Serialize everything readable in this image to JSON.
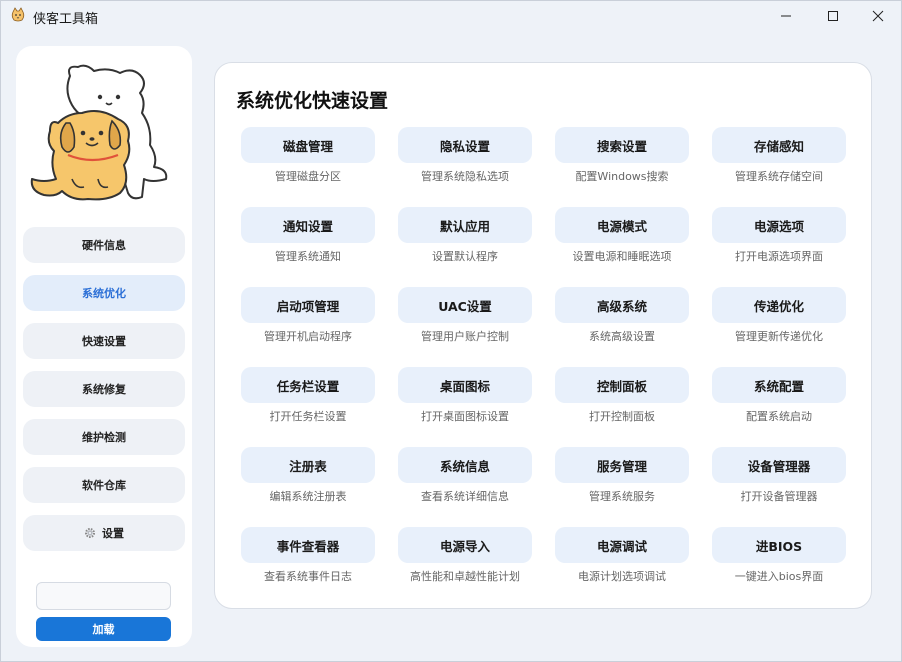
{
  "window": {
    "title": "侠客工具箱"
  },
  "sidebar": {
    "items": [
      {
        "label": "硬件信息"
      },
      {
        "label": "系统优化"
      },
      {
        "label": "快速设置"
      },
      {
        "label": "系统修复"
      },
      {
        "label": "维护检测"
      },
      {
        "label": "软件仓库"
      },
      {
        "label": "设置"
      }
    ],
    "active_index": 1,
    "load_input_value": "",
    "load_button_label": "加载"
  },
  "main": {
    "title": "系统优化快速设置",
    "tiles": [
      {
        "label": "磁盘管理",
        "desc": "管理磁盘分区"
      },
      {
        "label": "隐私设置",
        "desc": "管理系统隐私选项"
      },
      {
        "label": "搜索设置",
        "desc": "配置Windows搜索"
      },
      {
        "label": "存储感知",
        "desc": "管理系统存储空间"
      },
      {
        "label": "通知设置",
        "desc": "管理系统通知"
      },
      {
        "label": "默认应用",
        "desc": "设置默认程序"
      },
      {
        "label": "电源模式",
        "desc": "设置电源和睡眠选项"
      },
      {
        "label": "电源选项",
        "desc": "打开电源选项界面"
      },
      {
        "label": "启动项管理",
        "desc": "管理开机启动程序"
      },
      {
        "label": "UAC设置",
        "desc": "管理用户账户控制"
      },
      {
        "label": "高级系统",
        "desc": "系统高级设置"
      },
      {
        "label": "传递优化",
        "desc": "管理更新传递优化"
      },
      {
        "label": "任务栏设置",
        "desc": "打开任务栏设置"
      },
      {
        "label": "桌面图标",
        "desc": "打开桌面图标设置"
      },
      {
        "label": "控制面板",
        "desc": "打开控制面板"
      },
      {
        "label": "系统配置",
        "desc": "配置系统启动"
      },
      {
        "label": "注册表",
        "desc": "编辑系统注册表"
      },
      {
        "label": "系统信息",
        "desc": "查看系统详细信息"
      },
      {
        "label": "服务管理",
        "desc": "管理系统服务"
      },
      {
        "label": "设备管理器",
        "desc": "打开设备管理器"
      },
      {
        "label": "事件查看器",
        "desc": "查看系统事件日志"
      },
      {
        "label": "电源导入",
        "desc": "高性能和卓越性能计划"
      },
      {
        "label": "电源调试",
        "desc": "电源计划选项调试"
      },
      {
        "label": "进BIOS",
        "desc": "一键进入bios界面"
      }
    ]
  },
  "icons": {
    "app": "cat-icon",
    "minimize": "minimize-icon",
    "maximize": "maximize-icon",
    "close": "close-icon",
    "settings": "gear-icon"
  },
  "colors": {
    "accent": "#1976d8",
    "active_nav_text": "#2b6fd6",
    "tile_bg": "#e8f0fb"
  }
}
